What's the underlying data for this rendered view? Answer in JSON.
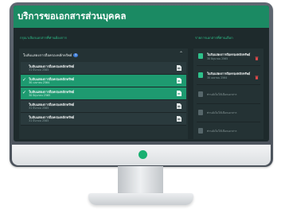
{
  "header": {
    "title": "บริการขอเอกสารส่วนบุคคล"
  },
  "sections": {
    "left_title": "กรุณาเลือกเอกสารที่ท่านต้องการ",
    "right_title": "รายการเอกสารที่ท่านเลือก"
  },
  "group": {
    "label": "ใบลับแสดงการถือครองหลักทรัพย์",
    "count": "5"
  },
  "doc_rows": [
    {
      "title": "ใบลับแสดงการถือครองหลักทรัพย์",
      "date": "31 มีนาคม 2565",
      "selected": false
    },
    {
      "title": "ใบลับแสดงการถือครองหลักทรัพย์",
      "date": "30 เมษายน 2564",
      "selected": true
    },
    {
      "title": "ใบลับแสดงการถือครองหลักทรัพย์",
      "date": "30 มิถุนายน 2565",
      "selected": true
    },
    {
      "title": "ใบลับแสดงการถือครองหลักทรัพย์",
      "date": "31 มีนาคม 2565",
      "selected": false
    },
    {
      "title": "ใบลับแสดงการถือครองหลักทรัพย์",
      "date": "31 มีนาคม 2565",
      "selected": false
    }
  ],
  "selected_items": [
    {
      "title": "ใบลับแสดงการถือครองหลักทรัพย์",
      "date": "30 มิถุนายน 2565"
    },
    {
      "title": "ใบลับแสดงการถือครองหลักทรัพย์",
      "date": "30 เมษายน 2564"
    }
  ],
  "empty_slots": [
    "ท่านยังไม่ได้เลือกเอกสาร",
    "ท่านยังไม่ได้เลือกเอกสาร",
    "ท่านยังไม่ได้เลือกเอกสาร"
  ],
  "colors": {
    "accent": "#1b8a63",
    "selected_row": "#1e9a70",
    "doc_icon_selected": "#2ec08a",
    "trash": "#e04a4a",
    "panel": "#243234"
  },
  "icons": {
    "check": "check-icon",
    "document": "document-icon",
    "trash": "trash-icon",
    "chevron": "chevron-up-icon"
  }
}
